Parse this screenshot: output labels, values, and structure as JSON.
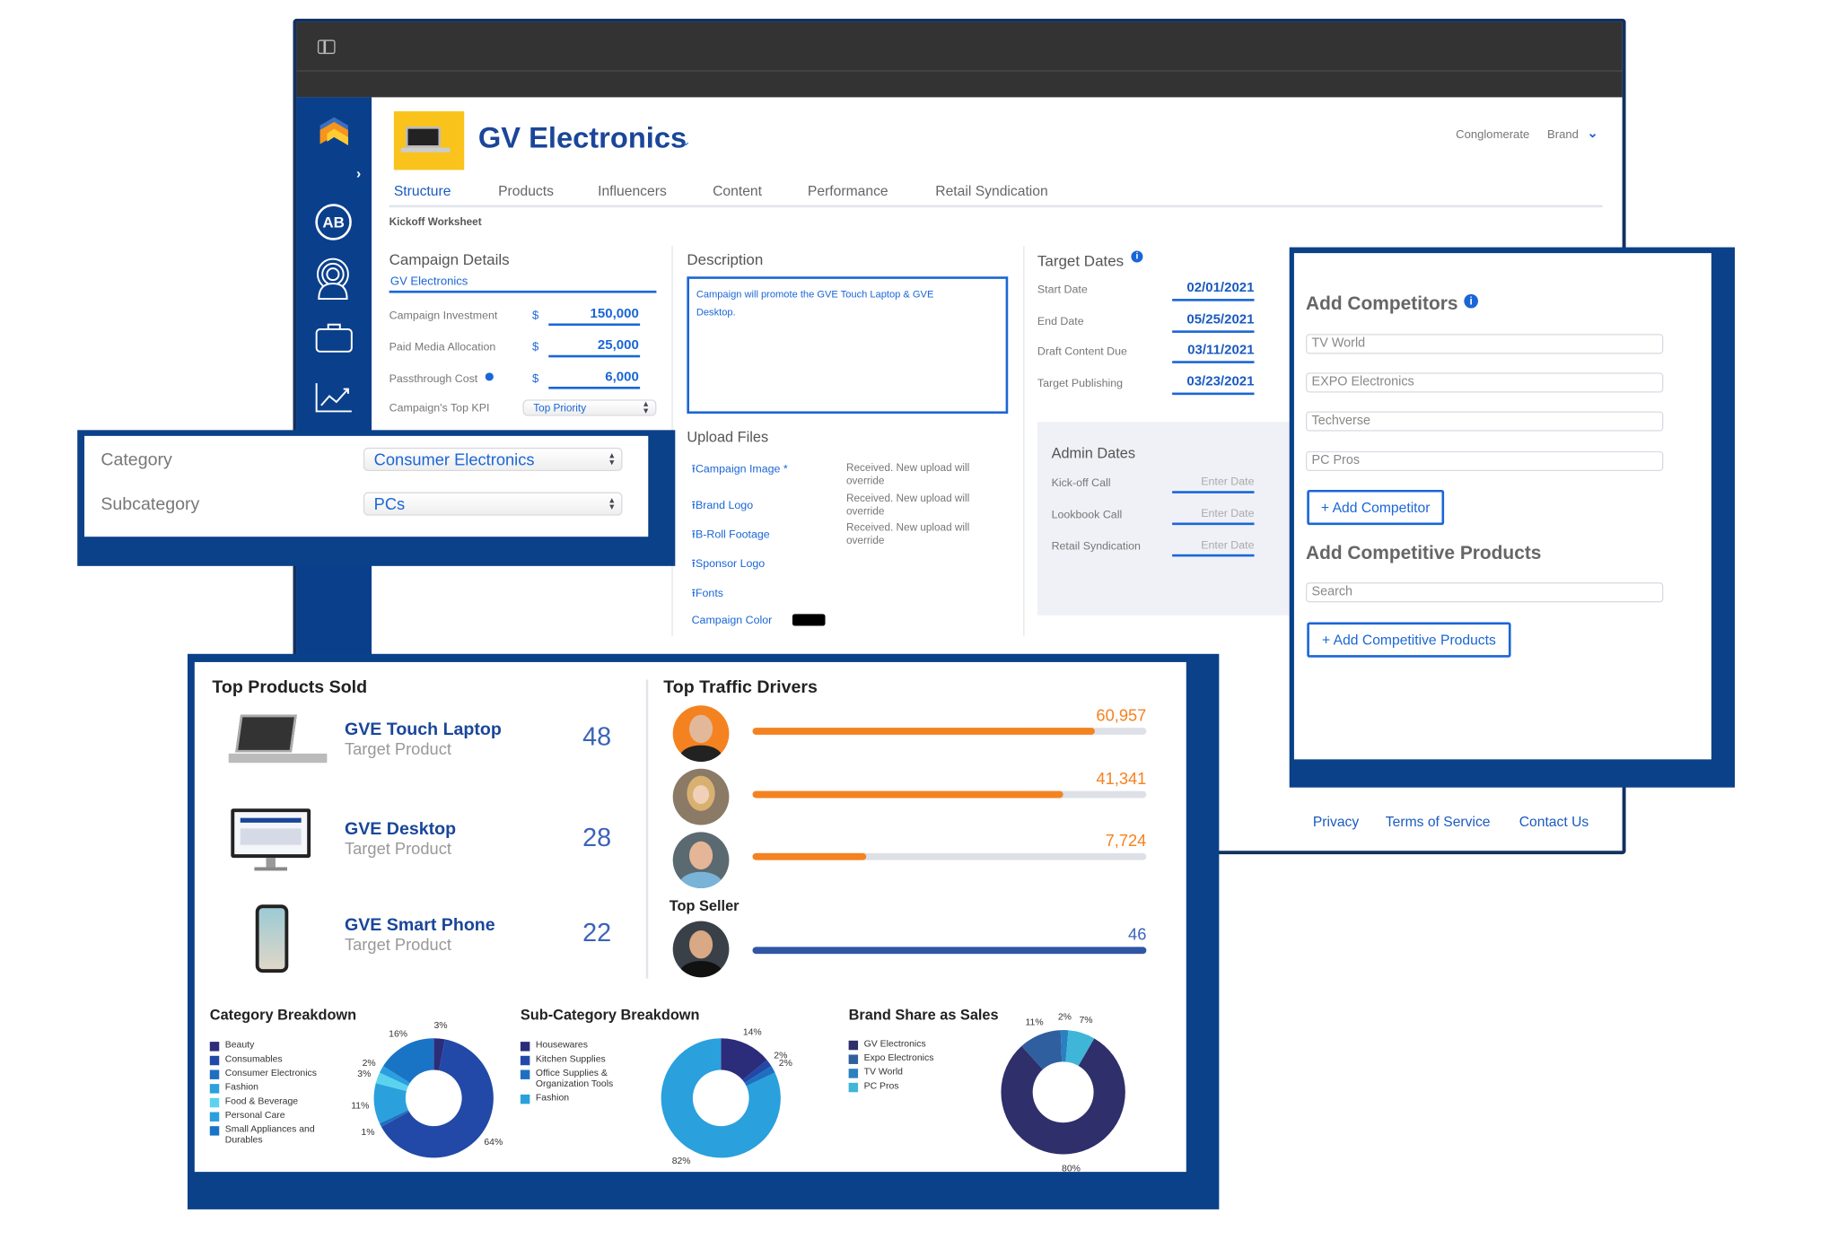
{
  "header": {
    "brand_name": "GV Electronics",
    "conglomerate_label": "Conglomerate",
    "brand_label": "Brand"
  },
  "tabs": [
    "Structure",
    "Products",
    "Influencers",
    "Content",
    "Performance",
    "Retail Syndication"
  ],
  "section_label": "Kickoff Worksheet",
  "campaign": {
    "title": "Campaign Details",
    "brand_value": "GV Electronics",
    "rows": [
      {
        "label": "Campaign Investment",
        "currency": "$",
        "value": "150,000"
      },
      {
        "label": "Paid Media Allocation",
        "currency": "$",
        "value": "25,000"
      },
      {
        "label": "Passthrough Cost",
        "currency": "$",
        "value": "6,000"
      }
    ],
    "kpi_label": "Campaign's Top KPI",
    "kpi_value": "Top Priority"
  },
  "description": {
    "title": "Description",
    "text": "Campaign will promote the GVE Touch Laptop & GVE Desktop."
  },
  "target_dates": {
    "title": "Target Dates",
    "rows": [
      {
        "label": "Start Date",
        "value": "02/01/2021"
      },
      {
        "label": "End Date",
        "value": "05/25/2021"
      },
      {
        "label": "Draft Content Due",
        "value": "03/11/2021"
      },
      {
        "label": "Target Publishing",
        "value": "03/23/2021"
      }
    ]
  },
  "upload": {
    "title": "Upload Files",
    "items": [
      "Campaign Image *",
      "Brand Logo",
      "B-Roll Footage",
      "Sponsor Logo",
      "Fonts"
    ],
    "status": "Received. New upload will override",
    "color_label": "Campaign Color",
    "color": "#000000"
  },
  "admin_dates": {
    "title": "Admin Dates",
    "rows": [
      "Kick-off Call",
      "Lookbook Call",
      "Retail Syndication"
    ],
    "placeholder": "Enter Date"
  },
  "category": {
    "category_label": "Category",
    "category_value": "Consumer Electronics",
    "subcategory_label": "Subcategory",
    "subcategory_value": "PCs"
  },
  "competitors": {
    "title": "Add Competitors",
    "items": [
      "TV World",
      "EXPO Electronics",
      "Techverse",
      "PC Pros"
    ],
    "add_button": "+ Add Competitor",
    "products_title": "Add Competitive Products",
    "search_placeholder": "Search",
    "add_products_button": "+ Add Competitive Products"
  },
  "footer": {
    "privacy": "Privacy",
    "terms": "Terms of Service",
    "contact": "Contact Us"
  },
  "top_products": {
    "title": "Top Products Sold",
    "items": [
      {
        "name": "GVE Touch Laptop",
        "sub": "Target Product",
        "count": "48"
      },
      {
        "name": "GVE Desktop",
        "sub": "Target Product",
        "count": "28"
      },
      {
        "name": "GVE Smart Phone",
        "sub": "Target Product",
        "count": "22"
      }
    ]
  },
  "traffic": {
    "title": "Top Traffic Drivers",
    "drivers": [
      {
        "value": "60,957",
        "fraction": 0.87
      },
      {
        "value": "41,341",
        "fraction": 0.79
      },
      {
        "value": "7,724",
        "fraction": 0.29
      }
    ],
    "top_seller_label": "Top Seller",
    "top_seller": {
      "value": "46",
      "fraction": 1.0
    },
    "colors": {
      "driver": "#f58220",
      "seller": "#2f55a4"
    }
  },
  "chart_data": [
    {
      "type": "pie",
      "title": "Category Breakdown",
      "categories": [
        "Beauty",
        "Consumables",
        "Consumer Electronics",
        "Fashion",
        "Food & Beverage",
        "Personal Care",
        "Small Appliances and Durables"
      ],
      "values": [
        3,
        64,
        1,
        11,
        3,
        2,
        16
      ],
      "colors": [
        "#2b2d7a",
        "#2249a8",
        "#1f6fc0",
        "#2aa0dd",
        "#5bd3ee",
        "#2a9fe0",
        "#1a74c6"
      ],
      "donut": true
    },
    {
      "type": "pie",
      "title": "Sub-Category Breakdown",
      "categories": [
        "Housewares",
        "Kitchen Supplies",
        "Office Supplies & Organization Tools",
        "Fashion"
      ],
      "values": [
        14,
        2,
        2,
        82
      ],
      "colors": [
        "#2b2d7a",
        "#2249a8",
        "#1f6fc0",
        "#2aa0dd"
      ],
      "donut": true
    },
    {
      "type": "pie",
      "title": "Brand Share as Sales",
      "categories": [
        "GV Electronics",
        "Expo Electronics",
        "TV World",
        "PC Pros"
      ],
      "values": [
        80,
        11,
        2,
        7
      ],
      "colors": [
        "#2e2f6b",
        "#2f5f9e",
        "#2a80c0",
        "#3fb5d8"
      ],
      "donut": true
    }
  ]
}
